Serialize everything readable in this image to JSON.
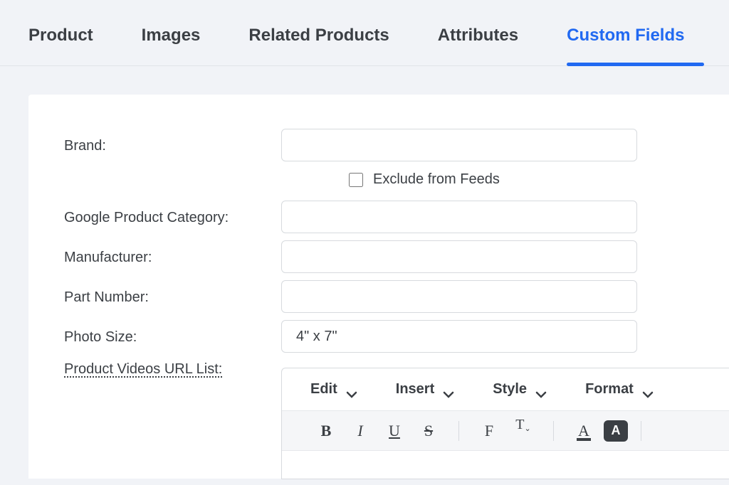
{
  "tabs": [
    {
      "label": "Product",
      "active": false
    },
    {
      "label": "Images",
      "active": false
    },
    {
      "label": "Related Products",
      "active": false
    },
    {
      "label": "Attributes",
      "active": false
    },
    {
      "label": "Custom Fields",
      "active": true
    }
  ],
  "form": {
    "brand": {
      "label": "Brand:",
      "value": ""
    },
    "exclude_feeds": {
      "label": "Exclude from Feeds",
      "checked": false
    },
    "google_cat": {
      "label": "Google Product Category:",
      "value": ""
    },
    "manufacturer": {
      "label": "Manufacturer:",
      "value": ""
    },
    "part_number": {
      "label": "Part Number:",
      "value": ""
    },
    "photo_size": {
      "label": "Photo Size:",
      "value": "4\" x 7\""
    },
    "videos": {
      "label": "Product Videos URL List:"
    }
  },
  "editor": {
    "menus": {
      "edit": "Edit",
      "insert": "Insert",
      "style": "Style",
      "format": "Format"
    },
    "tools": {
      "bold": "B",
      "italic": "I",
      "underline": "U",
      "strike": "S",
      "fontfam": "F",
      "fontsize": "T",
      "fontsize_sub": "⌄",
      "fontcolor": "A",
      "highlight": "A"
    }
  }
}
